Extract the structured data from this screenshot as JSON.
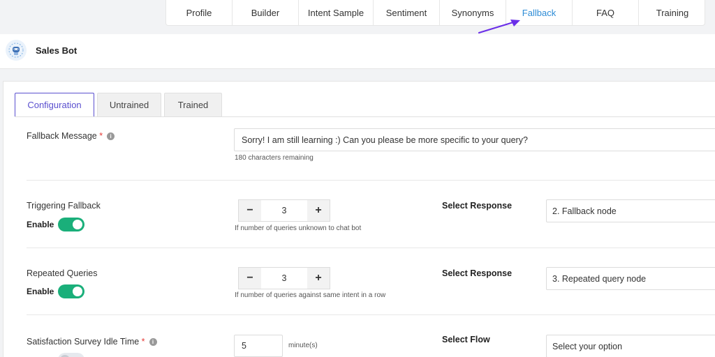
{
  "top_tabs": [
    {
      "label": "Profile"
    },
    {
      "label": "Builder"
    },
    {
      "label": "Intent Sample"
    },
    {
      "label": "Sentiment"
    },
    {
      "label": "Synonyms"
    },
    {
      "label": "Fallback"
    },
    {
      "label": "FAQ"
    },
    {
      "label": "Training"
    }
  ],
  "active_top_tab": "Fallback",
  "colors": {
    "accent": "#2d8cd6",
    "active_subtab": "#5a4fcf",
    "toggle_on": "#1aaf7a",
    "arrow": "#6a2ee8",
    "required": "#e53935"
  },
  "header": {
    "bot_name": "Sales Bot",
    "avatar_icon": "robot-icon"
  },
  "sub_tabs": [
    {
      "label": "Configuration"
    },
    {
      "label": "Untrained"
    },
    {
      "label": "Trained"
    }
  ],
  "fallback_message": {
    "label": "Fallback Message",
    "required_mark": "*",
    "value": "Sorry! I am still learning :) Can you please be more specific to your query?",
    "chars_remaining": "180 characters remaining"
  },
  "triggering_fallback": {
    "label": "Triggering Fallback",
    "enable_label": "Enable",
    "enabled": true,
    "count": "3",
    "minus": "−",
    "plus": "+",
    "hint": "If number of queries unknown to chat bot",
    "select_label": "Select Response",
    "select_value": "2. Fallback node"
  },
  "repeated_queries": {
    "label": "Repeated Queries",
    "enable_label": "Enable",
    "enabled": true,
    "count": "3",
    "minus": "−",
    "plus": "+",
    "hint": "If number of queries against same intent in a row",
    "select_label": "Select Response",
    "select_value": "3. Repeated query node"
  },
  "survey_idle": {
    "label": "Satisfaction Survey Idle Time",
    "required_mark": "*",
    "value": "5",
    "unit": "minute(s)",
    "select_label": "Select Flow",
    "select_placeholder": "Select your option"
  }
}
